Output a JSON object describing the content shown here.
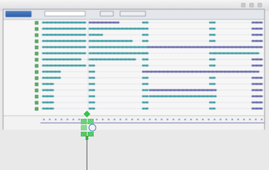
{
  "window": {
    "toolbar": {
      "tab_label": "",
      "field_text": "",
      "button1_label": "",
      "button2_label": ""
    },
    "rows": [
      {
        "label": ""
      },
      {
        "label": ""
      },
      {
        "label": ""
      },
      {
        "label": ""
      },
      {
        "label": ""
      },
      {
        "label": ""
      },
      {
        "label": ""
      },
      {
        "label": ""
      },
      {
        "label": ""
      },
      {
        "label": ""
      },
      {
        "label": ""
      },
      {
        "label": ""
      },
      {
        "label": ""
      },
      {
        "label": ""
      },
      {
        "label": ""
      }
    ],
    "footer": {
      "label": ""
    }
  },
  "colors": {
    "bar": "#3a9aa2",
    "bar_light": "#7ab7c0",
    "bar_purple": "#6366a8",
    "row_label": "#4a6aa6",
    "check": "#5fb86a",
    "accent": "#2f5ea6"
  }
}
